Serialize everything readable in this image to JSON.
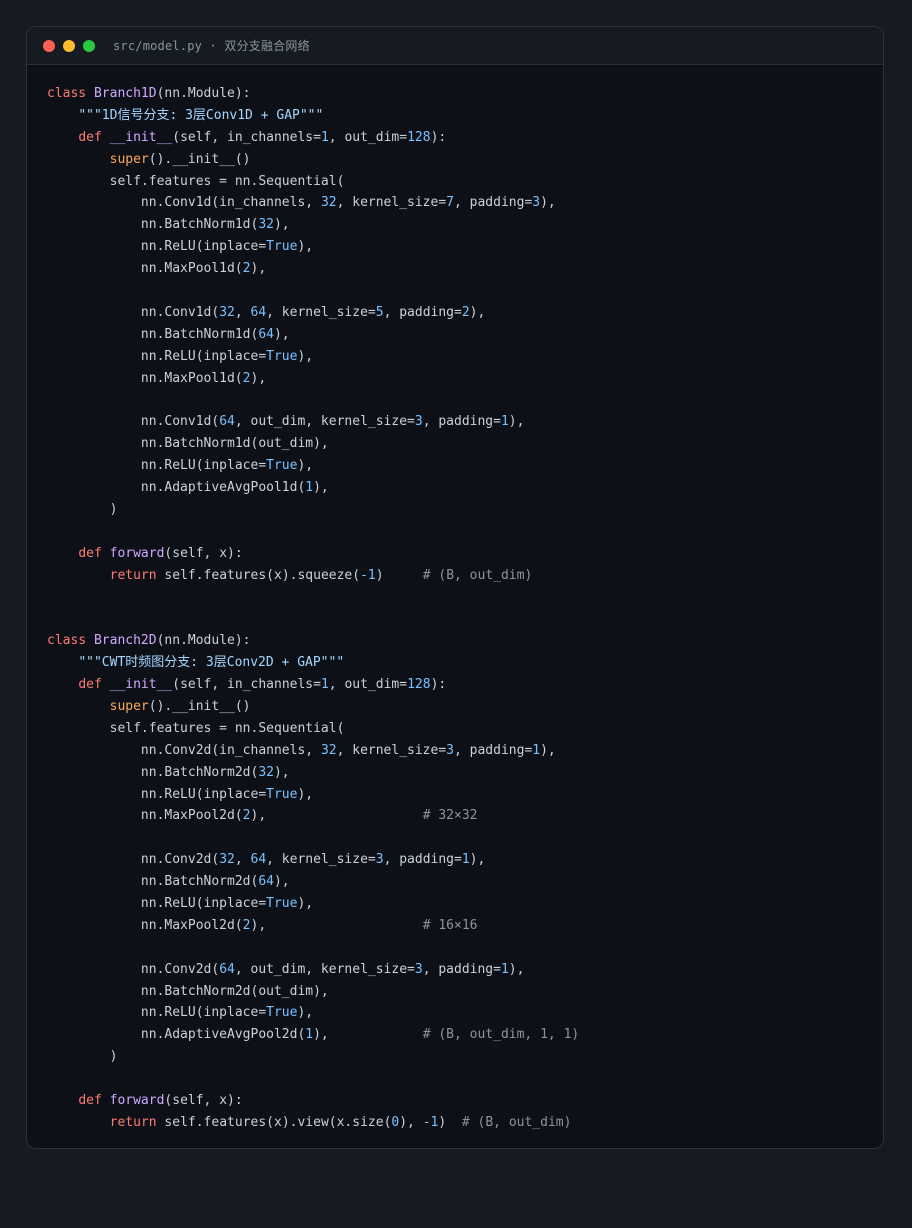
{
  "window": {
    "title": "src/model.py · 双分支融合网络",
    "controls": [
      {
        "name": "close",
        "color": "#ff5f57"
      },
      {
        "name": "minimize",
        "color": "#febc2e"
      },
      {
        "name": "maximize",
        "color": "#28c840"
      }
    ]
  },
  "colors": {
    "kw": "#ff7b72",
    "fn": "#d2a8ff",
    "num": "#79c0ff",
    "str": "#a5d6ff",
    "bi": "#ffa657",
    "cm": "#8b949e",
    "tx": "#c9d1d9"
  },
  "code_lines": [
    [
      [
        "kw",
        "class "
      ],
      [
        "fn",
        "Branch1D"
      ],
      [
        "tx",
        "(nn.Module):"
      ]
    ],
    [
      [
        "tx",
        "    "
      ],
      [
        "str",
        "\"\"\"1D信号分支: 3层Conv1D + GAP\"\"\""
      ]
    ],
    [
      [
        "tx",
        "    "
      ],
      [
        "kw",
        "def "
      ],
      [
        "fn",
        "__init__"
      ],
      [
        "tx",
        "(self, in_channels="
      ],
      [
        "num",
        "1"
      ],
      [
        "tx",
        ", out_dim="
      ],
      [
        "num",
        "128"
      ],
      [
        "tx",
        "):"
      ]
    ],
    [
      [
        "tx",
        "        "
      ],
      [
        "bi",
        "super"
      ],
      [
        "tx",
        "().__init__()"
      ]
    ],
    [
      [
        "tx",
        "        self.features = nn.Sequential("
      ]
    ],
    [
      [
        "tx",
        "            nn.Conv1d(in_channels, "
      ],
      [
        "num",
        "32"
      ],
      [
        "tx",
        ", kernel_size="
      ],
      [
        "num",
        "7"
      ],
      [
        "tx",
        ", padding="
      ],
      [
        "num",
        "3"
      ],
      [
        "tx",
        "),"
      ]
    ],
    [
      [
        "tx",
        "            nn.BatchNorm1d("
      ],
      [
        "num",
        "32"
      ],
      [
        "tx",
        "),"
      ]
    ],
    [
      [
        "tx",
        "            nn.ReLU(inplace="
      ],
      [
        "num",
        "True"
      ],
      [
        "tx",
        "),"
      ]
    ],
    [
      [
        "tx",
        "            nn.MaxPool1d("
      ],
      [
        "num",
        "2"
      ],
      [
        "tx",
        "),"
      ]
    ],
    [],
    [
      [
        "tx",
        "            nn.Conv1d("
      ],
      [
        "num",
        "32"
      ],
      [
        "tx",
        ", "
      ],
      [
        "num",
        "64"
      ],
      [
        "tx",
        ", kernel_size="
      ],
      [
        "num",
        "5"
      ],
      [
        "tx",
        ", padding="
      ],
      [
        "num",
        "2"
      ],
      [
        "tx",
        "),"
      ]
    ],
    [
      [
        "tx",
        "            nn.BatchNorm1d("
      ],
      [
        "num",
        "64"
      ],
      [
        "tx",
        "),"
      ]
    ],
    [
      [
        "tx",
        "            nn.ReLU(inplace="
      ],
      [
        "num",
        "True"
      ],
      [
        "tx",
        "),"
      ]
    ],
    [
      [
        "tx",
        "            nn.MaxPool1d("
      ],
      [
        "num",
        "2"
      ],
      [
        "tx",
        "),"
      ]
    ],
    [],
    [
      [
        "tx",
        "            nn.Conv1d("
      ],
      [
        "num",
        "64"
      ],
      [
        "tx",
        ", out_dim, kernel_size="
      ],
      [
        "num",
        "3"
      ],
      [
        "tx",
        ", padding="
      ],
      [
        "num",
        "1"
      ],
      [
        "tx",
        "),"
      ]
    ],
    [
      [
        "tx",
        "            nn.BatchNorm1d(out_dim),"
      ]
    ],
    [
      [
        "tx",
        "            nn.ReLU(inplace="
      ],
      [
        "num",
        "True"
      ],
      [
        "tx",
        "),"
      ]
    ],
    [
      [
        "tx",
        "            nn.AdaptiveAvgPool1d("
      ],
      [
        "num",
        "1"
      ],
      [
        "tx",
        "),"
      ]
    ],
    [
      [
        "tx",
        "        )"
      ]
    ],
    [],
    [
      [
        "tx",
        "    "
      ],
      [
        "kw",
        "def "
      ],
      [
        "fn",
        "forward"
      ],
      [
        "tx",
        "(self, x):"
      ]
    ],
    [
      [
        "tx",
        "        "
      ],
      [
        "kw",
        "return "
      ],
      [
        "tx",
        "self.features(x).squeeze("
      ],
      [
        "num",
        "-1"
      ],
      [
        "tx",
        ")     "
      ],
      [
        "cm",
        "# (B, out_dim)"
      ]
    ],
    [],
    [],
    [
      [
        "kw",
        "class "
      ],
      [
        "fn",
        "Branch2D"
      ],
      [
        "tx",
        "(nn.Module):"
      ]
    ],
    [
      [
        "tx",
        "    "
      ],
      [
        "str",
        "\"\"\"CWT时频图分支: 3层Conv2D + GAP\"\"\""
      ]
    ],
    [
      [
        "tx",
        "    "
      ],
      [
        "kw",
        "def "
      ],
      [
        "fn",
        "__init__"
      ],
      [
        "tx",
        "(self, in_channels="
      ],
      [
        "num",
        "1"
      ],
      [
        "tx",
        ", out_dim="
      ],
      [
        "num",
        "128"
      ],
      [
        "tx",
        "):"
      ]
    ],
    [
      [
        "tx",
        "        "
      ],
      [
        "bi",
        "super"
      ],
      [
        "tx",
        "().__init__()"
      ]
    ],
    [
      [
        "tx",
        "        self.features = nn.Sequential("
      ]
    ],
    [
      [
        "tx",
        "            nn.Conv2d(in_channels, "
      ],
      [
        "num",
        "32"
      ],
      [
        "tx",
        ", kernel_size="
      ],
      [
        "num",
        "3"
      ],
      [
        "tx",
        ", padding="
      ],
      [
        "num",
        "1"
      ],
      [
        "tx",
        "),"
      ]
    ],
    [
      [
        "tx",
        "            nn.BatchNorm2d("
      ],
      [
        "num",
        "32"
      ],
      [
        "tx",
        "),"
      ]
    ],
    [
      [
        "tx",
        "            nn.ReLU(inplace="
      ],
      [
        "num",
        "True"
      ],
      [
        "tx",
        "),"
      ]
    ],
    [
      [
        "tx",
        "            nn.MaxPool2d("
      ],
      [
        "num",
        "2"
      ],
      [
        "tx",
        "),                    "
      ],
      [
        "cm",
        "# 32×32"
      ]
    ],
    [],
    [
      [
        "tx",
        "            nn.Conv2d("
      ],
      [
        "num",
        "32"
      ],
      [
        "tx",
        ", "
      ],
      [
        "num",
        "64"
      ],
      [
        "tx",
        ", kernel_size="
      ],
      [
        "num",
        "3"
      ],
      [
        "tx",
        ", padding="
      ],
      [
        "num",
        "1"
      ],
      [
        "tx",
        "),"
      ]
    ],
    [
      [
        "tx",
        "            nn.BatchNorm2d("
      ],
      [
        "num",
        "64"
      ],
      [
        "tx",
        "),"
      ]
    ],
    [
      [
        "tx",
        "            nn.ReLU(inplace="
      ],
      [
        "num",
        "True"
      ],
      [
        "tx",
        "),"
      ]
    ],
    [
      [
        "tx",
        "            nn.MaxPool2d("
      ],
      [
        "num",
        "2"
      ],
      [
        "tx",
        "),                    "
      ],
      [
        "cm",
        "# 16×16"
      ]
    ],
    [],
    [
      [
        "tx",
        "            nn.Conv2d("
      ],
      [
        "num",
        "64"
      ],
      [
        "tx",
        ", out_dim, kernel_size="
      ],
      [
        "num",
        "3"
      ],
      [
        "tx",
        ", padding="
      ],
      [
        "num",
        "1"
      ],
      [
        "tx",
        "),"
      ]
    ],
    [
      [
        "tx",
        "            nn.BatchNorm2d(out_dim),"
      ]
    ],
    [
      [
        "tx",
        "            nn.ReLU(inplace="
      ],
      [
        "num",
        "True"
      ],
      [
        "tx",
        "),"
      ]
    ],
    [
      [
        "tx",
        "            nn.AdaptiveAvgPool2d("
      ],
      [
        "num",
        "1"
      ],
      [
        "tx",
        "),            "
      ],
      [
        "cm",
        "# (B, out_dim, 1, 1)"
      ]
    ],
    [
      [
        "tx",
        "        )"
      ]
    ],
    [],
    [
      [
        "tx",
        "    "
      ],
      [
        "kw",
        "def "
      ],
      [
        "fn",
        "forward"
      ],
      [
        "tx",
        "(self, x):"
      ]
    ],
    [
      [
        "tx",
        "        "
      ],
      [
        "kw",
        "return "
      ],
      [
        "tx",
        "self.features(x).view(x.size("
      ],
      [
        "num",
        "0"
      ],
      [
        "tx",
        "), "
      ],
      [
        "num",
        "-1"
      ],
      [
        "tx",
        ")  "
      ],
      [
        "cm",
        "# (B, out_dim)"
      ]
    ]
  ]
}
